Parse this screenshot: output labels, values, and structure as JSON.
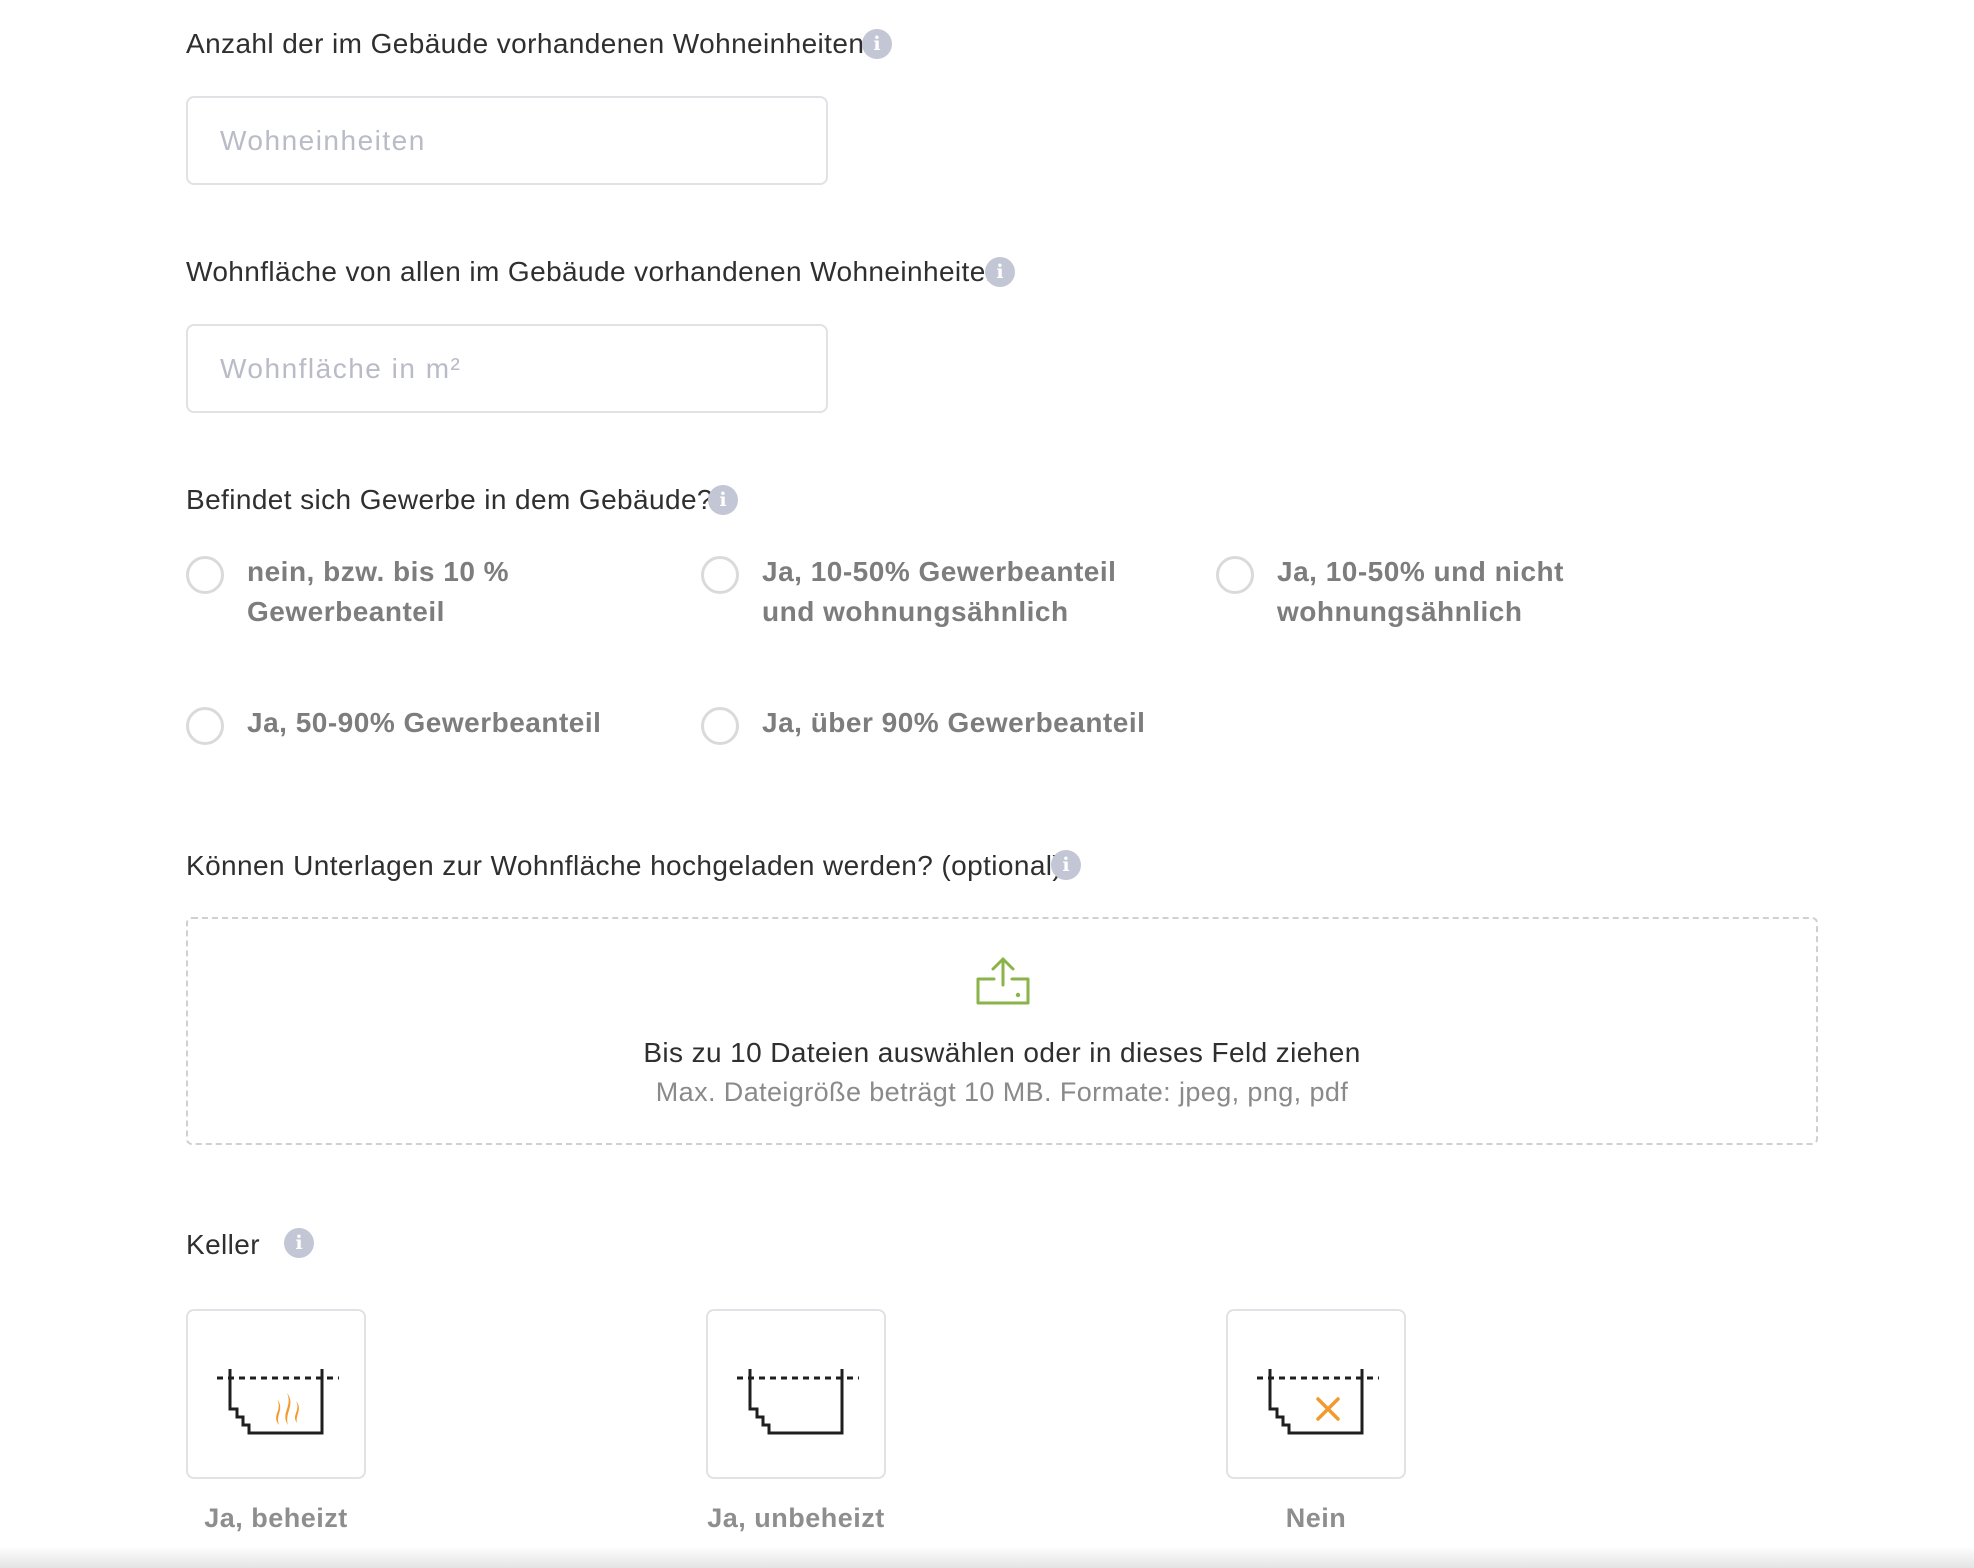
{
  "fields": {
    "wohneinheiten": {
      "label": "Anzahl der im Gebäude vorhandenen Wohneinheiten",
      "placeholder": "Wohneinheiten",
      "value": ""
    },
    "wohnflaeche": {
      "label": "Wohnfläche von allen im Gebäude vorhandenen Wohneinheiten",
      "placeholder": "Wohnfläche in m²",
      "value": ""
    }
  },
  "gewerbe": {
    "label": "Befindet sich Gewerbe in dem Gebäude?",
    "options": [
      {
        "line1": "nein, bzw. bis 10 %",
        "line2": "Gewerbeanteil",
        "selected": false
      },
      {
        "line1": "Ja, 10-50% Gewerbeanteil",
        "line2": "und wohnungsähnlich",
        "selected": false
      },
      {
        "line1": "Ja, 10-50% und nicht",
        "line2": "wohnungsähnlich",
        "selected": false
      },
      {
        "line1": "Ja, 50-90% Gewerbeanteil",
        "line2": "",
        "selected": false
      },
      {
        "line1": "Ja, über 90% Gewerbeanteil",
        "line2": "",
        "selected": false
      }
    ]
  },
  "upload": {
    "label": "Können Unterlagen zur Wohnfläche hochgeladen werden? (optional)",
    "main_text": "Bis zu 10 Dateien auswählen oder in dieses Feld ziehen",
    "sub_text": "Max. Dateigröße beträgt 10 MB. Formate: jpeg, png, pdf",
    "icon": "upload-icon",
    "icon_color": "#8ab34a"
  },
  "keller": {
    "label": "Keller",
    "options": [
      {
        "label": "Ja, beheizt",
        "icon": "heated-basement-icon"
      },
      {
        "label": "Ja, unbeheizt",
        "icon": "unheated-basement-icon"
      },
      {
        "label": "Nein",
        "icon": "no-basement-icon"
      }
    ],
    "accent_color": "#f29a2e"
  },
  "colors": {
    "info_icon": "#c3c6d4",
    "radio_border": "#dadada",
    "input_border": "#e2e2e6"
  }
}
